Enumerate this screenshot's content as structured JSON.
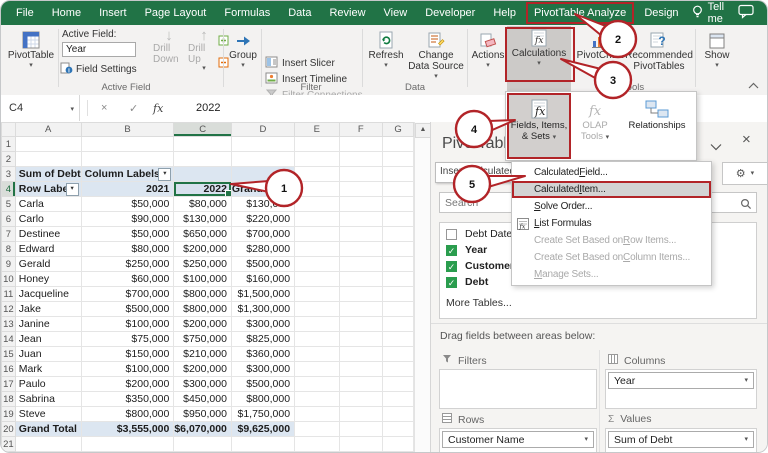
{
  "tabs": [
    {
      "label": "File"
    },
    {
      "label": "Home"
    },
    {
      "label": "Insert"
    },
    {
      "label": "Page Layout"
    },
    {
      "label": "Formulas"
    },
    {
      "label": "Data"
    },
    {
      "label": "Review"
    },
    {
      "label": "View"
    },
    {
      "label": "Developer"
    },
    {
      "label": "Help"
    },
    {
      "label": "PivotTable Analyze",
      "boxed": true
    },
    {
      "label": "Design"
    }
  ],
  "tell_me": "Tell me",
  "ribbon": {
    "pivottable": "PivotTable",
    "active_field": {
      "label": "Active Field:",
      "value": "Year",
      "field_settings": "Field Settings",
      "drill_down": "Drill Down",
      "drill_up": "Drill Up",
      "group_label": "Active Field"
    },
    "group_button": "Group",
    "filter": {
      "insert_slicer": "Insert Slicer",
      "insert_timeline": "Insert Timeline",
      "filter_connections": "Filter Connections",
      "group_label": "Filter"
    },
    "data": {
      "refresh": "Refresh",
      "change_data_source": "Change Data Source",
      "group_label": "Data"
    },
    "actions": "Actions",
    "calculations": "Calculations",
    "tools": {
      "pivotchart": "PivotChart",
      "recommended": "Recommended PivotTables",
      "group_label": "Tools"
    },
    "show": "Show"
  },
  "formula_bar": {
    "cell_ref": "C4",
    "formula": "2022"
  },
  "sheet": {
    "columns": [
      "A",
      "B",
      "C",
      "D",
      "E",
      "F",
      "G"
    ],
    "selected_column": "C",
    "selected_row": 4,
    "pivot": {
      "title": "Sum of Debt",
      "col_labels": "Column Labels",
      "row_labels": "Row Labels",
      "years": [
        "2021",
        "2022"
      ],
      "grand_col": "Grand Total",
      "rows": [
        {
          "name": "Carla",
          "v2021": "$50,000",
          "v2022": "$80,000",
          "total": "$130,000"
        },
        {
          "name": "Carlo",
          "v2021": "$90,000",
          "v2022": "$130,000",
          "total": "$220,000"
        },
        {
          "name": "Destinee",
          "v2021": "$50,000",
          "v2022": "$650,000",
          "total": "$700,000"
        },
        {
          "name": "Edward",
          "v2021": "$80,000",
          "v2022": "$200,000",
          "total": "$280,000"
        },
        {
          "name": "Gerald",
          "v2021": "$250,000",
          "v2022": "$250,000",
          "total": "$500,000"
        },
        {
          "name": "Honey",
          "v2021": "$60,000",
          "v2022": "$100,000",
          "total": "$160,000"
        },
        {
          "name": "Jacqueline",
          "v2021": "$700,000",
          "v2022": "$800,000",
          "total": "$1,500,000"
        },
        {
          "name": "Jake",
          "v2021": "$500,000",
          "v2022": "$800,000",
          "total": "$1,300,000"
        },
        {
          "name": "Janine",
          "v2021": "$100,000",
          "v2022": "$200,000",
          "total": "$300,000"
        },
        {
          "name": "Jean",
          "v2021": "$75,000",
          "v2022": "$750,000",
          "total": "$825,000"
        },
        {
          "name": "Juan",
          "v2021": "$150,000",
          "v2022": "$210,000",
          "total": "$360,000"
        },
        {
          "name": "Mark",
          "v2021": "$100,000",
          "v2022": "$200,000",
          "total": "$300,000"
        },
        {
          "name": "Paulo",
          "v2021": "$200,000",
          "v2022": "$300,000",
          "total": "$500,000"
        },
        {
          "name": "Sabrina",
          "v2021": "$350,000",
          "v2022": "$450,000",
          "total": "$800,000"
        },
        {
          "name": "Steve",
          "v2021": "$800,000",
          "v2022": "$950,000",
          "total": "$1,750,000"
        }
      ],
      "grand_total": {
        "name": "Grand Total",
        "v2021": "$3,555,000",
        "v2022": "$6,070,000",
        "total": "$9,625,000"
      }
    }
  },
  "calc_flyout": {
    "buttons": [
      {
        "label": "Fields, Items, & Sets",
        "lines": [
          "Fields, Items,",
          "& Sets"
        ],
        "boxed": true,
        "pressed": true
      },
      {
        "label": "OLAP Tools",
        "lines": [
          "OLAP",
          "Tools"
        ],
        "disabled": true
      },
      {
        "label": "Relationships",
        "lines": [
          "Relationships"
        ]
      }
    ]
  },
  "calc_menu": {
    "items": [
      {
        "pre": "Calculated ",
        "key": "F",
        "post": "ield..."
      },
      {
        "pre": "Calculated ",
        "key": "I",
        "post": "tem...",
        "selected": true
      },
      {
        "pre": "",
        "key": "S",
        "post": "olve Order..."
      },
      {
        "pre": "",
        "key": "L",
        "post": "ist Formulas",
        "icon": "list-formulas-icon"
      },
      {
        "pre": "Create Set Based on ",
        "key": "R",
        "post": "ow Items...",
        "disabled": true
      },
      {
        "pre": "Create Set Based on ",
        "key": "C",
        "post": "olumn Items...",
        "disabled": true
      },
      {
        "pre": "",
        "key": "M",
        "post": "anage Sets...",
        "disabled": true
      }
    ]
  },
  "pane": {
    "title": "PivotTable Fields",
    "search_placeholder": "Search",
    "fields": [
      {
        "label": "Debt Date",
        "checked": false
      },
      {
        "label": "Year",
        "checked": true
      },
      {
        "label": "Customer Name",
        "checked": true
      },
      {
        "label": "Debt",
        "checked": true
      }
    ],
    "more_tables": "More Tables...",
    "drag_hint": "Drag fields between areas below:",
    "areas": {
      "filters": {
        "label": "Filters",
        "items": []
      },
      "columns": {
        "label": "Columns",
        "items": [
          "Year"
        ]
      },
      "rows": {
        "label": "Rows",
        "items": [
          "Customer Name"
        ]
      },
      "values": {
        "label": "Values",
        "items": [
          "Sum of Debt"
        ]
      }
    }
  },
  "tooltip": "Insert Calculated Item",
  "callouts": [
    {
      "n": "1"
    },
    {
      "n": "2"
    },
    {
      "n": "3"
    },
    {
      "n": "4"
    },
    {
      "n": "5"
    }
  ],
  "colors": {
    "excel_green": "#217346",
    "annotation_red": "#b22428",
    "pivot_header_bg": "#dce6f1",
    "check_green": "#2a9d4e"
  }
}
